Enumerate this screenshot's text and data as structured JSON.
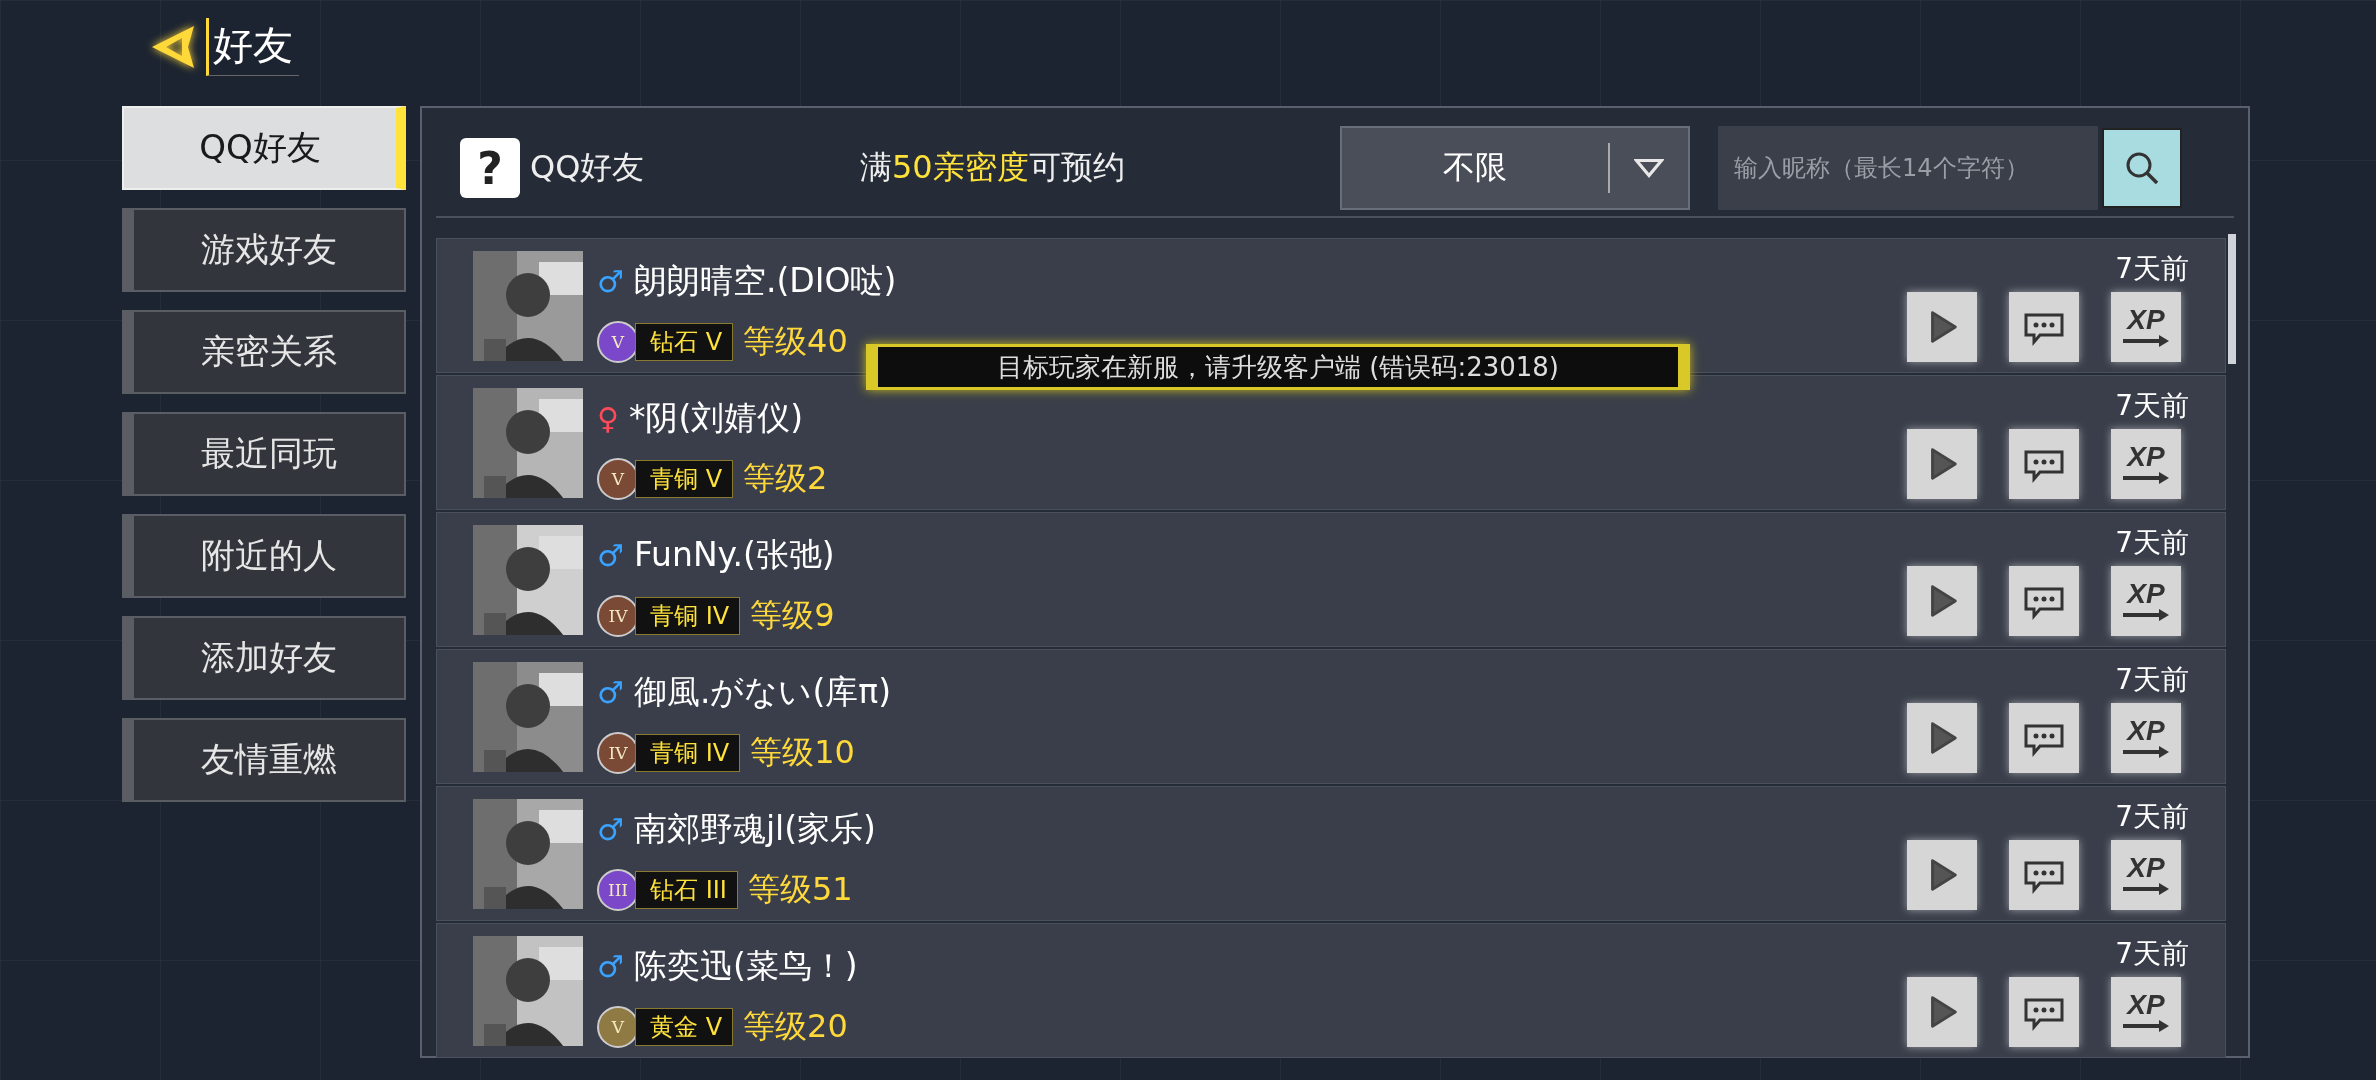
{
  "header": {
    "title": "好友"
  },
  "sidebar": {
    "items": [
      {
        "label": "QQ好友",
        "selected": true
      },
      {
        "label": "游戏好友",
        "selected": false
      },
      {
        "label": "亲密关系",
        "selected": false
      },
      {
        "label": "最近同玩",
        "selected": false
      },
      {
        "label": "附近的人",
        "selected": false
      },
      {
        "label": "添加好友",
        "selected": false
      },
      {
        "label": "友情重燃",
        "selected": false
      }
    ]
  },
  "toolbar": {
    "help_icon": "?",
    "title": "QQ好友",
    "notice": "满**50亲密度**可预约",
    "filter": "不限",
    "search": {
      "placeholder": "输入昵称（最长14个字符）"
    }
  },
  "friends": [
    {
      "name": "朗朗晴空.(DIO哒)",
      "gender": {
        "symbol": "♂",
        "color": "#3aa2ff"
      },
      "medal": {
        "numeral": "V",
        "color": "#7a48c8"
      },
      "rank": "钻石 V",
      "level": "等级40",
      "last_seen": "7天前",
      "xp": "XP"
    },
    {
      "name": "*阴(刘婧仪)",
      "gender": {
        "symbol": "♀",
        "color": "#ff4a5a"
      },
      "medal": {
        "numeral": "V",
        "color": "#7a4a36"
      },
      "rank": "青铜 V",
      "level": "等级2",
      "last_seen": "7天前",
      "xp": "XP"
    },
    {
      "name": "FunNy.(张弛)",
      "gender": {
        "symbol": "♂",
        "color": "#3aa2ff"
      },
      "medal": {
        "numeral": "IV",
        "color": "#7a4a36"
      },
      "rank": "青铜 IV",
      "level": "等级9",
      "last_seen": "7天前",
      "xp": "XP"
    },
    {
      "name": "御風.がない(库π)",
      "gender": {
        "symbol": "♂",
        "color": "#3aa2ff"
      },
      "medal": {
        "numeral": "IV",
        "color": "#7a4a36"
      },
      "rank": "青铜 IV",
      "level": "等级10",
      "last_seen": "7天前",
      "xp": "XP"
    },
    {
      "name": "南郊野魂jl(家乐)",
      "gender": {
        "symbol": "♂",
        "color": "#3aa2ff"
      },
      "medal": {
        "numeral": "III",
        "color": "#7a48c8"
      },
      "rank": "钻石 III",
      "level": "等级51",
      "last_seen": "7天前",
      "xp": "XP"
    },
    {
      "name": "陈奕迅(菜鸟！)",
      "gender": {
        "symbol": "♂",
        "color": "#3aa2ff"
      },
      "medal": {
        "numeral": "V",
        "color": "#8f7a44"
      },
      "rank": "黄金 V",
      "level": "等级20",
      "last_seen": "7天前",
      "xp": "XP"
    }
  ],
  "toast": {
    "message": "目标玩家在新服，请升级客户端 (错误码:23018)"
  }
}
